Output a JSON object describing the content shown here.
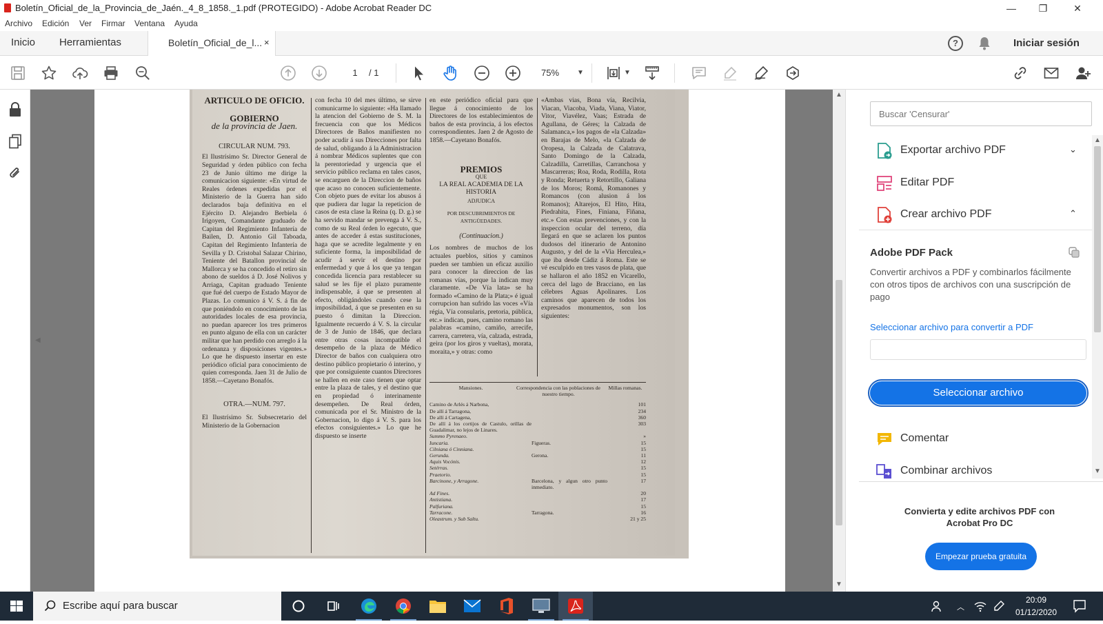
{
  "window": {
    "title": "Boletín_Oficial_de_la_Provincia_de_Jaén._4_8_1858._1.pdf (PROTEGIDO) - Adobe Acrobat Reader DC",
    "minimize": "—",
    "maximize": "❐",
    "close": "✕"
  },
  "menu": [
    "Archivo",
    "Edición",
    "Ver",
    "Firmar",
    "Ventana",
    "Ayuda"
  ],
  "tabs": {
    "home": "Inicio",
    "tools": "Herramientas",
    "document": "Boletín_Oficial_de_l...",
    "document_close": "×",
    "help": "?",
    "signin": "Iniciar sesión"
  },
  "toolbar": {
    "page_current": "1",
    "page_total": "/ 1",
    "zoom": "75%"
  },
  "document": {
    "columns": [
      {
        "heading1": "ARTICULO DE OFICIO.",
        "heading2": "GOBIERNO",
        "heading3": "de la provincia de Jaen.",
        "heading4": "CIRCULAR NUM. 793.",
        "body": "El Ilustrísimo Sr. Director General de Seguridad y órden público con fecha 23 de Junio último me dirige la comunicacion siguiente: «En virtud de Reales órdenes expedidas por el Ministerio de la Guerra han sido declarados baja definitiva en el Ejército D. Alejandro Berbiela ó Irigoyen, Comandante graduado de Capitan del Regimiento Infantería de Bailen, D. Antonio Gil Taboada, Capitan del Regimiento Infantería de Sevilla y D. Cristobal Salazar Chirino, Teniente del Batallon provincial de Mallorca y se ha concedido el retiro sin abono de sueldos á D. José Nolivos y Arriaga, Capitan graduado Teniente que fué del cuerpo de Estado Mayor de Plazas. Lo comunico á V. S. á fin de que poniéndolo en conocimiento de las autoridades locales de esa provincia, no puedan aparecer los tres primeros en punto alguno de ella con un carácter militar que han perdido con arreglo á la ordenanza y disposiciones vigentes.» Lo que he dispuesto insertar en este periódico oficial para conocimiento de quien corresponda. Jaen 31 de Julio de 1858.—Cayetano Bonafós.",
        "heading5": "OTRA.—NUM. 797.",
        "body2": "El Ilustrísimo Sr. Subsecretario del Ministerio de la Gobernacion"
      },
      {
        "body": "con fecha 10 del mes último, se sirve comunicarme lo siguiente: «Ha llamado la atencion del Gobierno de S. M. la frecuencia con que los Médicos Directores de Baños manifiesten no poder acudir á sus Direcciones por falta de salud, obligando á la Administracion á nombrar Médicos suplentes que con la perentoriedad y urgencia que el servicio público reclama en tales casos, se encarguen de la Direccion de baños que acaso no conocen suficientemente. Con objeto pues de evitar los abusos á que pudiera dar lugar la repeticion de casos de esta clase la Reina (q. D. g.) se ha servido mandar se prevenga á V. S., como de su Real órden lo egecuto, que antes de acceder á estas sustituciones, haga que se acredite legalmente y en suficiente forma, la imposibilidad de acudir á servir el destino por enfermedad y que á los que ya tengan concedida licencia para restablecer su salud se les fije el plazo puramente indispensable, á que se presenten al efecto, obligándoles cuando cese la imposibilidad, á que se presenten en su puesto ó dimitan la Direccion. Igualmente recuerdo á V. S. la circular de 3 de Junio de 1846, que declara entre otras cosas incompatible el desempeño de la plaza de Médico Director de baños con cualquiera otro destino público propietario ó interino, y que por consiguiente cuantos Directores se hallen en este caso tienen que optar entre la plaza de tales, y el destino que en propiedad ó interinamente desempeñen. De Real órden, comunicada por el Sr. Ministro de la Gobernacion, lo digo á V. S. para los efectos consiguientes.» Lo que he dispuesto se inserte"
      },
      {
        "body_top": "en este periódico oficial para que llegue á conocimiento de los Directores de los establecimientos de baños de esta provincia, á los efectos correspondientes. Jaen 2 de Agosto de 1858.—Cayetano Bonafós.",
        "heading1": "PREMIOS",
        "heading2": "QUE",
        "heading3": "LA REAL ACADEMIA DE LA HISTORIA",
        "heading4": "ADJUDICA",
        "heading5": "POR DESCUBRIMIENTOS DE ANTIGÜEDADES.",
        "heading6": "(Continuacion.)",
        "body": "Los nombres de muchos de los actuales pueblos, sitios y caminos pueden ser tambien un eficaz auxilio para conocer la direccion de las romanas vías, porque la indican muy claramente. «De Vía lata» se ha formado «Camino de la Plata;» é igual corrupcion han sufrido las voces «Vía régia, Vía consularis, pretoria, pública, etc.» indican, pues, camino romano las palabras «camino, camiño, arrecife, carrera, carretera, vía, calzada, estrada, geira (por los giros y vueltas), morata, moraita,» y otras: como"
      },
      {
        "body": "«Ambas vias, Bona vía, Recilvia, Viacan, Viacoba, Viada, Viana, Viator, Vitor, Viavélez, Vaas; Estrada de Agullana, de Géres; la Calzada de Salamanca,» los pagos de «la Calzada» en Barajas de Melo, «la Calzada de Oropesa, la Calzada de Calatrava, Santo Domingo de la Calzada, Calzadilla, Carretillas, Carranchosa y Mascarreras; Roa, Roda, Rodilla, Rota y Ronda; Retuerta y Retortillo, Galiana de los Moros; Romá, Romanones y Romancos (con alusion á los Romanos); Altarejos, El Hito, Hita, Piedrahita, Fines, Finiana, Fiñana, etc.» Con estas prevenciones, y con la inspeccion ocular del terreno, día llegará en que se aclaren los puntos dudosos del itinerario de Antonino Augusto, y del de la «Via Herculea,» que iba desde Cádiz á Roma. Este se vé esculpido en tres vasos de plata, que se hallaron el año 1852 en Vicarello, cerca del lago de Bracciano, en las célebres Aguas Apolinares. Los caminos que aparecen de todos los expresados monumentos, son los siguientes:"
      }
    ],
    "table": {
      "headers": [
        "Mansiones.",
        "Correspondencia con las poblaciones de nuestro tiempo.",
        "Millas romanas."
      ],
      "rows": [
        [
          "Camino de Arlés á Narbona,",
          "",
          "101"
        ],
        [
          "De allí á Tarragona,",
          "",
          "234"
        ],
        [
          "De allí á Cartagena,",
          "",
          "360"
        ],
        [
          "De allí á los cortijos de Castulo, orillas de Guadalimar, no lejos de Linares.",
          "",
          "303"
        ],
        [
          "Summo Pyrenaeo.",
          "",
          "»"
        ],
        [
          "Iuncaria.",
          "Figueras.",
          "15"
        ],
        [
          "Cilniana ó Cinniana.",
          "",
          "15"
        ],
        [
          "Gerunda.",
          "Gerona.",
          "11"
        ],
        [
          "Aquis Vocónis.",
          "",
          "12"
        ],
        [
          "Setérras.",
          "",
          "15"
        ],
        [
          "Praetorio.",
          "",
          "15"
        ],
        [
          "Barcinone, y Arragone.",
          "Barcelona, y algun otro punto inmediato.",
          "17"
        ],
        [
          "Ad Fines.",
          "",
          "20"
        ],
        [
          "Antistiana.",
          "",
          "17"
        ],
        [
          "Palfuriana.",
          "",
          "15"
        ],
        [
          "Tarracone.",
          "Tarragona.",
          "16"
        ],
        [
          "Oleastrum. y Sub Saltu.",
          "",
          "21 y 25"
        ]
      ]
    }
  },
  "right_panel": {
    "search_placeholder": "Buscar 'Censurar'",
    "tools": [
      {
        "label": "Exportar archivo PDF",
        "chevron": "⌄"
      },
      {
        "label": "Editar PDF",
        "chevron": ""
      },
      {
        "label": "Crear archivo PDF",
        "chevron": "⌃"
      }
    ],
    "pack_title": "Adobe PDF Pack",
    "pack_desc": "Convertir archivos a PDF y combinarlos fácilmente con otros tipos de archivos con una suscripción de pago",
    "select_link": "Seleccionar archivo para convertir a PDF",
    "select_button": "Seleccionar archivo",
    "more_tools": [
      {
        "label": "Comentar"
      },
      {
        "label": "Combinar archivos"
      }
    ],
    "promo": "Convierta y edite archivos PDF con Acrobat Pro DC",
    "trial_button": "Empezar prueba gratuita"
  },
  "taskbar": {
    "search_placeholder": "Escribe aquí para buscar",
    "time": "20:09",
    "date": "01/12/2020"
  },
  "colors": {
    "accent": "#1473e6",
    "acrobat_red": "#d9241c",
    "taskbar": "#1f2b38",
    "doc_background": "#7a7a7a"
  }
}
